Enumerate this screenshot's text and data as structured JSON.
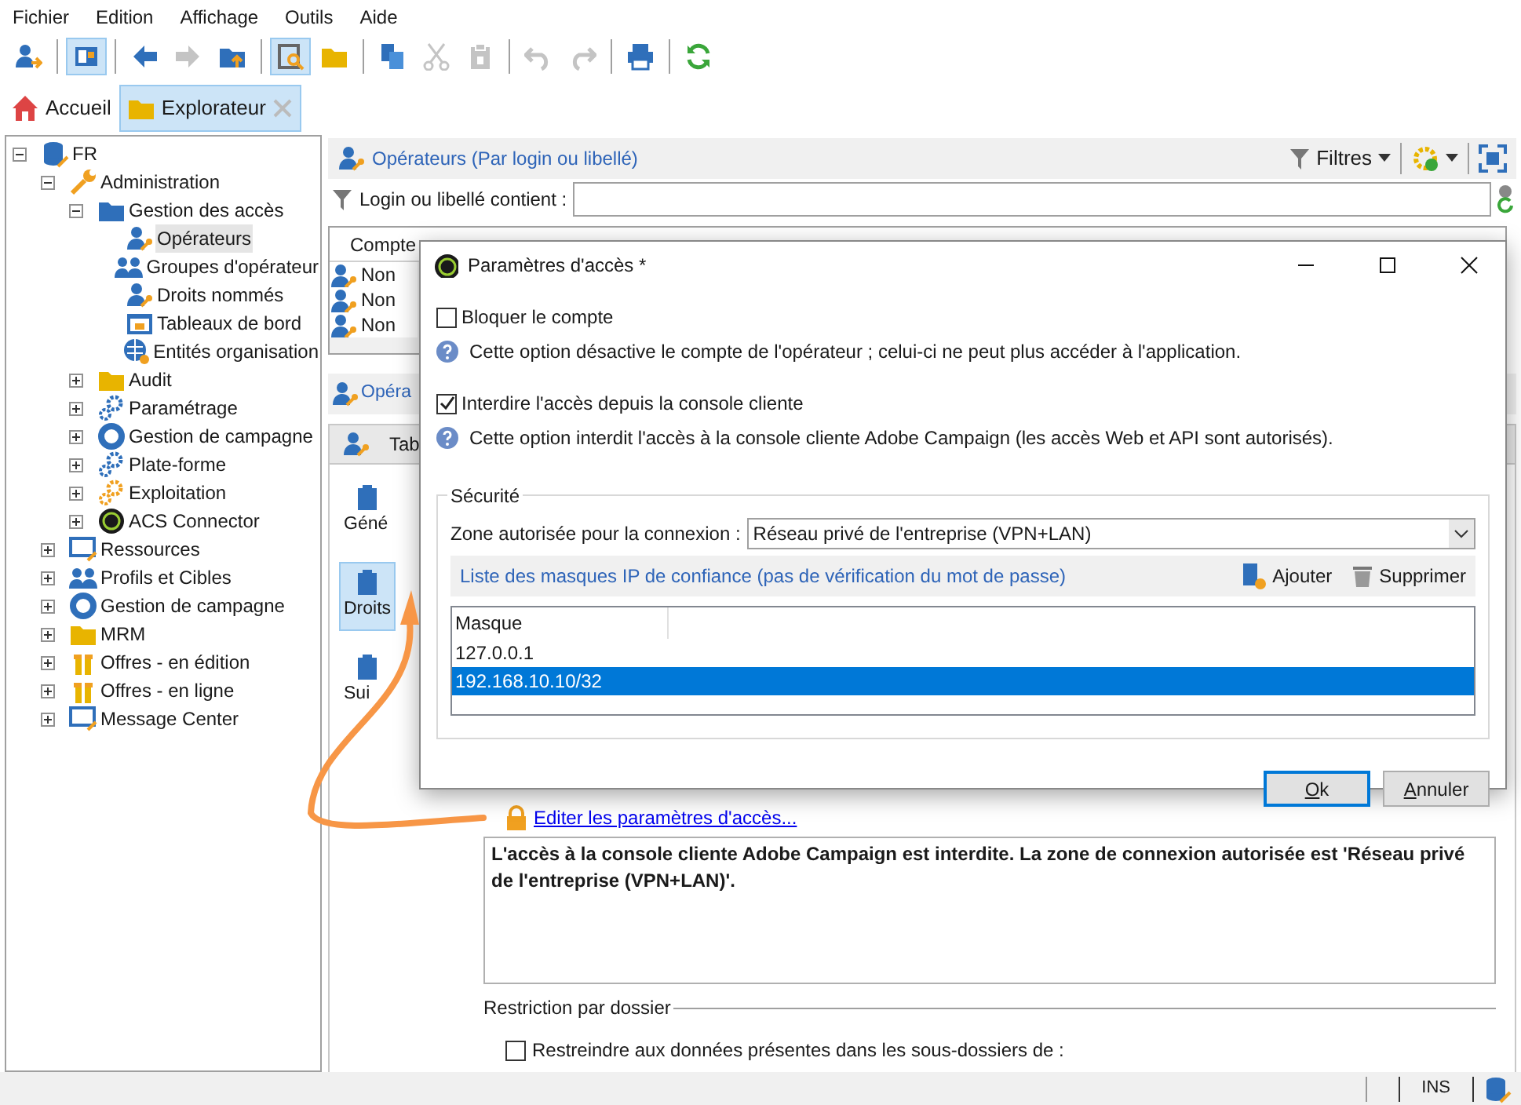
{
  "menu": [
    "Fichier",
    "Edition",
    "Affichage",
    "Outils",
    "Aide"
  ],
  "toolbar": [
    [
      {
        "selected": false,
        "disabled": false
      }
    ],
    [
      {
        "selected": true,
        "disabled": false
      }
    ],
    [
      {
        "selected": false,
        "disabled": false
      },
      {
        "selected": false,
        "disabled": true
      },
      {
        "selected": false,
        "disabled": false
      }
    ],
    [
      {
        "selected": true,
        "disabled": false
      },
      {
        "selected": false,
        "disabled": false
      }
    ],
    [
      {
        "selected": false,
        "disabled": false
      },
      {
        "selected": false,
        "disabled": true
      },
      {
        "selected": false,
        "disabled": true
      }
    ],
    [
      {
        "selected": false,
        "disabled": true
      },
      {
        "selected": false,
        "disabled": true
      }
    ],
    [
      {
        "selected": false,
        "disabled": false
      }
    ],
    [
      {
        "selected": false,
        "disabled": false
      }
    ]
  ],
  "tabs": [
    {
      "label": "Accueil",
      "selected": false
    },
    {
      "label": "Explorateur",
      "selected": true
    }
  ],
  "tree": [
    {
      "label": "FR",
      "expanded": true,
      "selected": false,
      "children": [
        {
          "label": "Administration",
          "expanded": true,
          "selected": false,
          "children": [
            {
              "label": "Gestion des accès",
              "expanded": true,
              "selected": false,
              "children": [
                {
                  "label": "Opérateurs",
                  "selected": true
                },
                {
                  "label": "Groupes d'opérateur",
                  "selected": false
                },
                {
                  "label": "Droits nommés",
                  "selected": false
                },
                {
                  "label": "Tableaux de bord",
                  "selected": false
                },
                {
                  "label": "Entités organisation",
                  "selected": false
                }
              ]
            },
            {
              "label": "Audit",
              "expanded": false,
              "selected": false
            },
            {
              "label": "Paramétrage",
              "expanded": false,
              "selected": false
            },
            {
              "label": "Gestion de campagne",
              "expanded": false,
              "selected": false
            },
            {
              "label": "Plate-forme",
              "expanded": false,
              "selected": false
            },
            {
              "label": "Exploitation",
              "expanded": false,
              "selected": false
            },
            {
              "label": "ACS Connector",
              "expanded": false,
              "selected": false
            }
          ]
        },
        {
          "label": "Ressources",
          "expanded": false,
          "selected": false
        },
        {
          "label": "Profils et Cibles",
          "expanded": false,
          "selected": false
        },
        {
          "label": "Gestion de campagne",
          "expanded": false,
          "selected": false
        },
        {
          "label": "MRM",
          "expanded": false,
          "selected": false
        },
        {
          "label": "Offres - en édition",
          "expanded": false,
          "selected": false
        },
        {
          "label": "Offres - en ligne",
          "expanded": false,
          "selected": false
        },
        {
          "label": "Message Center",
          "expanded": false,
          "selected": false
        }
      ]
    }
  ],
  "list_panel": {
    "title": "Opérateurs (Par login ou libellé)",
    "filters": "Filtres",
    "filter_label": "Login ou libellé contient :"
  },
  "operators_table": {
    "columns": [
      "Compte"
    ],
    "rows": [
      {
        "cells": [
          "Non"
        ]
      },
      {
        "cells": [
          "Non"
        ]
      },
      {
        "cells": [
          "Non"
        ]
      }
    ]
  },
  "detail": {
    "header": "Opéra",
    "tab": "Tab",
    "nav": [
      {
        "label": "Géné",
        "selected": false
      },
      {
        "label": "Droits",
        "selected": true
      },
      {
        "label": "Sui",
        "selected": false
      }
    ],
    "edit_link": "Editer les paramètres d'accès...",
    "summary": "L'accès à la console cliente Adobe Campaign est interdite. La zone de connexion autorisée est 'Réseau privé de l'entreprise (VPN+LAN)'.",
    "restriction_title": "Restriction par dossier",
    "restrict": {
      "label": "Restreindre aux données présentes dans les sous-dossiers de :",
      "checked": false
    }
  },
  "dialog": {
    "title": "Paramètres d'accès *",
    "options": [
      {
        "label": "Bloquer le compte",
        "checked": false,
        "help": "Cette option désactive le compte de l'opérateur ; celui-ci ne peut plus accéder à l'application."
      },
      {
        "label": "Interdire l'accès depuis la console cliente",
        "checked": true,
        "help": "Cette option interdit l'accès à la console cliente Adobe Campaign (les accès Web et API sont autorisés)."
      }
    ],
    "security": {
      "title": "Sécurité",
      "zone_label": "Zone autorisée pour la connexion :",
      "zone_value": "Réseau privé de l'entreprise (VPN+LAN)",
      "masks_title": "Liste des masques IP de confiance (pas de vérification du mot de passe)",
      "add": "Ajouter",
      "remove": "Supprimer",
      "column": "Masque",
      "masks": [
        {
          "value": "127.0.0.1",
          "selected": false
        },
        {
          "value": "192.168.10.10/32",
          "selected": true
        }
      ]
    },
    "buttons": [
      {
        "label": "Ok",
        "default": true
      },
      {
        "label": "Annuler",
        "default": false
      }
    ]
  },
  "status_bar": {
    "mode": "INS"
  }
}
